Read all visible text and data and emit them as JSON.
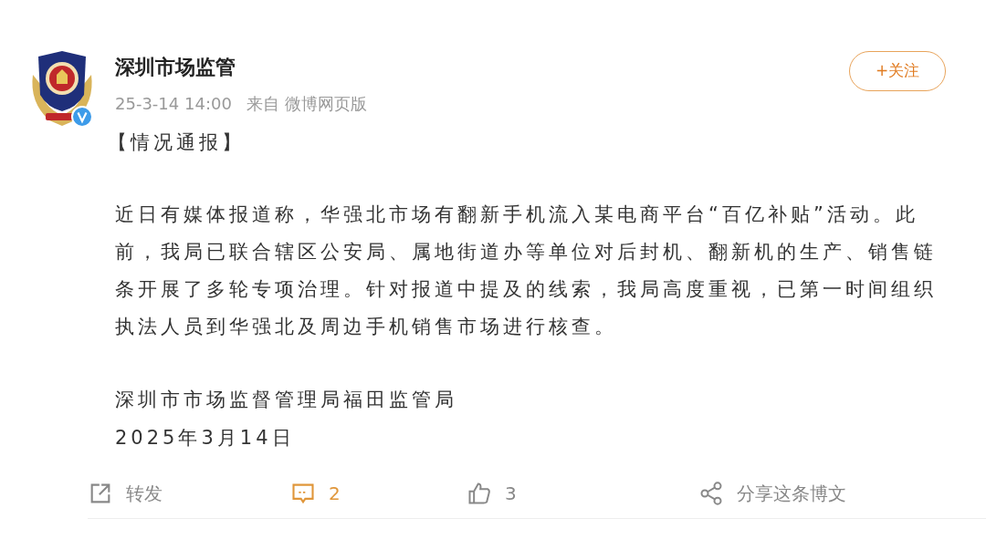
{
  "post": {
    "author": "深圳市场监管",
    "verified": true,
    "follow_button": "+关注",
    "time": "25-3-14 14:00",
    "source_prefix": "来自",
    "source": "微博网页版",
    "paragraphs": [
      "【情况通报】",
      "近日有媒体报道称，华强北市场有翻新手机流入某电商平台“百亿补贴”活动。此前，我局已联合辖区公安局、属地街道办等单位对后封机、翻新机的生产、销售链条开展了多轮专项治理。针对报道中提及的线索，我局高度重视，已第一时间组织执法人员到华强北及周边手机销售市场进行核查。",
      "深圳市市场监督管理局福田监管局\n2025年3月14日"
    ]
  },
  "actions": [
    {
      "kind": "repost",
      "label": "转发",
      "selected": false
    },
    {
      "kind": "comment",
      "label": "2",
      "selected": true
    },
    {
      "kind": "like",
      "label": "3",
      "selected": false
    },
    {
      "kind": "share",
      "label": "分享这条博文",
      "selected": false
    }
  ]
}
